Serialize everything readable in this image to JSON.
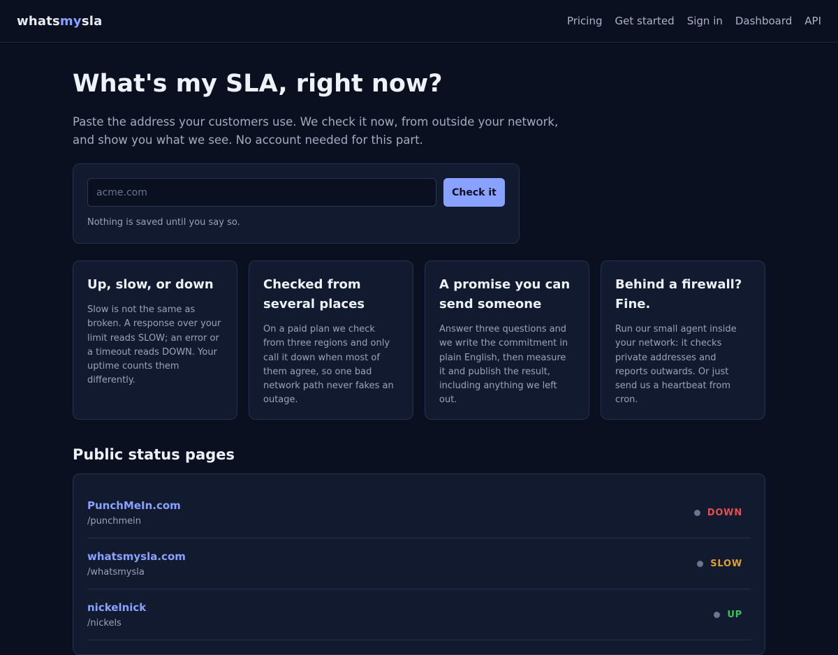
{
  "header": {
    "logo_part1": "whats",
    "logo_part2": "my",
    "logo_part3": "sla",
    "nav": [
      "Pricing",
      "Get started",
      "Sign in",
      "Dashboard",
      "API"
    ]
  },
  "hero": {
    "title": "What's my SLA, right now?",
    "subtitle": "Paste the address your customers use. We check it now, from outside your network, and show you what we see. No account needed for this part."
  },
  "check": {
    "placeholder": "acme.com",
    "value": "",
    "button_label": "Check it",
    "note": "Nothing is saved until you say so."
  },
  "features": [
    {
      "title": "Up, slow, or down",
      "body": "Slow is not the same as broken. A response over your limit reads SLOW; an error or a timeout reads DOWN. Your uptime counts them differently."
    },
    {
      "title": "Checked from several places",
      "body": "On a paid plan we check from three regions and only call it down when most of them agree, so one bad network path never fakes an outage."
    },
    {
      "title": "A promise you can send someone",
      "body": "Answer three questions and we write the commitment in plain English, then measure it and publish the result, including anything we left out."
    },
    {
      "title": "Behind a firewall? Fine.",
      "body": "Run our small agent inside your network: it checks private addresses and reports outwards. Or just send us a heartbeat from cron."
    }
  ],
  "status_section": {
    "title": "Public status pages",
    "rows": [
      {
        "name": "PunchMeIn.com",
        "path": "/punchmein",
        "status": "DOWN",
        "status_color": "#e05252"
      },
      {
        "name": "whatsmysla.com",
        "path": "/whatsmysla",
        "status": "SLOW",
        "status_color": "#e0a030"
      },
      {
        "name": "nickelnick",
        "path": "/nickels",
        "status": "UP",
        "status_color": "#3fbf62"
      }
    ]
  },
  "colors": {
    "background": "#0b1020",
    "panel": "#111a2e",
    "accent": "#8aa2ff",
    "border": "#263150"
  }
}
